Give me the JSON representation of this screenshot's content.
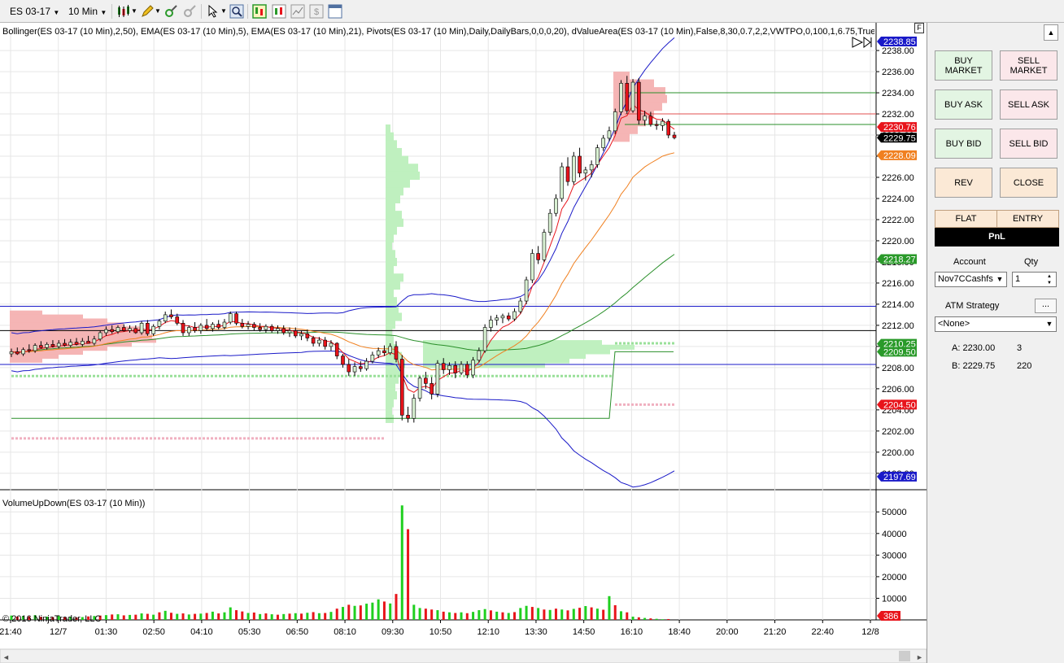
{
  "toolbar": {
    "instrument": "ES 03-17",
    "interval": "10 Min",
    "icons": [
      "candlestick-icon",
      "pencil-icon",
      "crosshair-icon",
      "magnet-icon",
      "cursor-icon",
      "zoom-icon",
      "properties-icon",
      "chart-style-icon",
      "data-box-icon",
      "dollar-icon"
    ]
  },
  "chart": {
    "indicator_label": "Bollinger(ES 03-17 (10 Min),2,50), EMA(ES 03-17 (10 Min),5), EMA(ES 03-17 (10 Min),21), Pivots(ES 03-17 (10 Min),Daily,DailyBars,0,0,0,20), dValueArea(ES 03-17 (10 Min),False,8,30,0.7,2,2,VWTPO,0,100,1,6.75,True",
    "volume_label": "VolumeUpDown(ES 03-17 (10 Min))",
    "copyright": "© 2016 NinjaTrader, LLC",
    "f_label": "F",
    "colors": {
      "up": "#d8f0d2",
      "down": "#e8141b",
      "ema5": "#e8141b",
      "ema21": "#f08020",
      "bollinger": "#1a1ac8",
      "pivot_green": "#2a8f2a",
      "pivot_red": "#e05050"
    }
  },
  "chart_data": {
    "type": "candlestick",
    "price_axis": {
      "ticks": [
        "2238.00",
        "2236.00",
        "2234.00",
        "2232.00",
        "2230.00",
        "2228.00",
        "2226.00",
        "2224.00",
        "2222.00",
        "2220.00",
        "2218.00",
        "2216.00",
        "2214.00",
        "2212.00",
        "2210.00",
        "2208.00",
        "2206.00",
        "2204.00",
        "2202.00",
        "2200.00",
        "2198.00"
      ],
      "ylim": [
        2196.6,
        2239.7
      ]
    },
    "volume_axis": {
      "ticks": [
        "50000",
        "40000",
        "30000",
        "20000",
        "10000"
      ],
      "ylim": [
        0,
        58000
      ]
    },
    "time_axis": [
      "21:40",
      "12/7",
      "01:30",
      "02:50",
      "04:10",
      "05:30",
      "06:50",
      "08:10",
      "09:30",
      "10:50",
      "12:10",
      "13:30",
      "14:50",
      "16:10",
      "18:40",
      "20:00",
      "21:20",
      "22:40",
      "12/8"
    ],
    "price_markers": [
      {
        "label": "2238.85",
        "price": 2238.85,
        "color": "#1a1ac8"
      },
      {
        "label": "2230.76",
        "price": 2230.76,
        "color": "#e8141b"
      },
      {
        "label": "2229.75",
        "price": 2229.75,
        "color": "#000000"
      },
      {
        "label": "2228.09",
        "price": 2228.09,
        "color": "#f08020"
      },
      {
        "label": "2218.27",
        "price": 2218.27,
        "color": "#2a9a2a"
      },
      {
        "label": "2210.25",
        "price": 2210.25,
        "color": "#2a9a2a"
      },
      {
        "label": "2209.50",
        "price": 2209.5,
        "color": "#2a9a2a"
      },
      {
        "label": "2204.50",
        "price": 2204.5,
        "color": "#e8141b"
      },
      {
        "label": "2197.69",
        "price": 2197.69,
        "color": "#1a1ac8"
      }
    ],
    "volume_marker": {
      "label": "386",
      "value": 386,
      "color": "#e8141b"
    },
    "candles": [
      [
        2209.3,
        2209.8,
        2209.0,
        2209.5
      ],
      [
        2209.5,
        2209.9,
        2209.2,
        2209.3
      ],
      [
        2209.3,
        2209.9,
        2209.1,
        2209.7
      ],
      [
        2209.7,
        2210.2,
        2209.4,
        2209.6
      ],
      [
        2209.6,
        2210.3,
        2209.4,
        2210.1
      ],
      [
        2210.1,
        2210.5,
        2209.8,
        2209.9
      ],
      [
        2209.9,
        2210.4,
        2209.7,
        2210.2
      ],
      [
        2210.2,
        2210.6,
        2209.9,
        2210.0
      ],
      [
        2210.0,
        2210.6,
        2209.8,
        2210.3
      ],
      [
        2210.3,
        2210.7,
        2210.0,
        2210.1
      ],
      [
        2210.1,
        2210.7,
        2209.9,
        2210.4
      ],
      [
        2210.4,
        2210.8,
        2210.1,
        2210.2
      ],
      [
        2210.2,
        2210.8,
        2210.0,
        2210.5
      ],
      [
        2210.5,
        2211.0,
        2210.3,
        2210.3
      ],
      [
        2210.3,
        2211.0,
        2210.1,
        2210.7
      ],
      [
        2210.7,
        2211.5,
        2210.5,
        2211.3
      ],
      [
        2211.3,
        2211.9,
        2211.0,
        2211.6
      ],
      [
        2211.6,
        2212.0,
        2211.2,
        2211.4
      ],
      [
        2211.4,
        2212.0,
        2211.2,
        2211.8
      ],
      [
        2211.8,
        2212.1,
        2211.4,
        2211.5
      ],
      [
        2211.5,
        2212.0,
        2211.3,
        2211.7
      ],
      [
        2211.7,
        2212.0,
        2211.2,
        2211.3
      ],
      [
        2211.3,
        2212.4,
        2211.1,
        2212.2
      ],
      [
        2212.2,
        2212.5,
        2211.0,
        2211.2
      ],
      [
        2211.2,
        2212.1,
        2211.0,
        2211.9
      ],
      [
        2211.9,
        2212.6,
        2211.6,
        2212.4
      ],
      [
        2212.4,
        2213.3,
        2212.2,
        2213.0
      ],
      [
        2213.0,
        2213.5,
        2212.6,
        2212.8
      ],
      [
        2212.8,
        2213.1,
        2212.0,
        2212.2
      ],
      [
        2212.2,
        2212.5,
        2211.0,
        2211.3
      ],
      [
        2211.3,
        2212.0,
        2211.0,
        2211.8
      ],
      [
        2211.8,
        2212.3,
        2211.3,
        2211.5
      ],
      [
        2211.5,
        2212.2,
        2211.2,
        2212.0
      ],
      [
        2212.0,
        2212.6,
        2211.5,
        2211.7
      ],
      [
        2211.7,
        2212.3,
        2211.4,
        2212.1
      ],
      [
        2212.1,
        2212.5,
        2211.6,
        2211.8
      ],
      [
        2211.8,
        2212.6,
        2211.6,
        2212.3
      ],
      [
        2212.3,
        2213.3,
        2212.1,
        2213.1
      ],
      [
        2213.1,
        2213.3,
        2212.0,
        2212.2
      ],
      [
        2212.2,
        2212.6,
        2211.7,
        2211.9
      ],
      [
        2211.9,
        2212.4,
        2211.6,
        2212.1
      ],
      [
        2212.1,
        2212.3,
        2211.5,
        2211.8
      ],
      [
        2211.8,
        2212.2,
        2211.4,
        2211.6
      ],
      [
        2211.6,
        2212.1,
        2211.3,
        2211.9
      ],
      [
        2211.9,
        2212.1,
        2211.3,
        2211.5
      ],
      [
        2211.5,
        2212.0,
        2211.2,
        2211.7
      ],
      [
        2211.7,
        2212.0,
        2211.1,
        2211.3
      ],
      [
        2211.3,
        2211.8,
        2210.9,
        2211.5
      ],
      [
        2211.5,
        2211.8,
        2210.8,
        2211.0
      ],
      [
        2211.0,
        2211.5,
        2210.6,
        2211.2
      ],
      [
        2211.2,
        2211.6,
        2210.5,
        2210.8
      ],
      [
        2210.8,
        2211.0,
        2210.0,
        2210.3
      ],
      [
        2210.3,
        2210.9,
        2210.0,
        2210.6
      ],
      [
        2210.6,
        2210.9,
        2209.7,
        2210.0
      ],
      [
        2210.0,
        2210.6,
        2209.6,
        2210.3
      ],
      [
        2210.3,
        2210.4,
        2208.8,
        2209.1
      ],
      [
        2209.1,
        2209.3,
        2208.0,
        2208.3
      ],
      [
        2208.3,
        2208.8,
        2207.2,
        2207.6
      ],
      [
        2207.6,
        2208.5,
        2207.2,
        2208.1
      ],
      [
        2208.1,
        2208.6,
        2207.6,
        2207.9
      ],
      [
        2207.9,
        2208.9,
        2207.7,
        2208.6
      ],
      [
        2208.6,
        2209.5,
        2208.4,
        2209.2
      ],
      [
        2209.2,
        2209.9,
        2208.9,
        2209.6
      ],
      [
        2209.6,
        2210.1,
        2209.1,
        2209.4
      ],
      [
        2209.4,
        2210.3,
        2209.2,
        2210.0
      ],
      [
        2210.0,
        2210.5,
        2208.5,
        2208.8
      ],
      [
        2208.8,
        2209.2,
        2203.0,
        2203.5
      ],
      [
        2203.5,
        2204.3,
        2202.8,
        2203.2
      ],
      [
        2203.2,
        2205.5,
        2202.8,
        2205.1
      ],
      [
        2205.1,
        2207.2,
        2204.8,
        2207.0
      ],
      [
        2207.0,
        2207.6,
        2206.0,
        2206.5
      ],
      [
        2206.5,
        2207.1,
        2205.0,
        2205.5
      ],
      [
        2205.5,
        2208.7,
        2205.2,
        2208.4
      ],
      [
        2208.4,
        2208.9,
        2207.4,
        2207.8
      ],
      [
        2207.8,
        2208.5,
        2207.3,
        2208.2
      ],
      [
        2208.2,
        2208.6,
        2207.0,
        2207.5
      ],
      [
        2207.5,
        2208.6,
        2207.3,
        2208.3
      ],
      [
        2208.3,
        2208.6,
        2207.0,
        2207.3
      ],
      [
        2207.3,
        2209.0,
        2207.0,
        2208.7
      ],
      [
        2208.7,
        2209.9,
        2208.5,
        2209.6
      ],
      [
        2209.6,
        2212.1,
        2209.4,
        2211.8
      ],
      [
        2211.8,
        2212.9,
        2211.4,
        2212.5
      ],
      [
        2212.5,
        2213.0,
        2212.0,
        2212.7
      ],
      [
        2212.7,
        2213.1,
        2212.2,
        2212.9
      ],
      [
        2212.9,
        2213.2,
        2212.4,
        2212.6
      ],
      [
        2212.6,
        2213.6,
        2212.4,
        2213.3
      ],
      [
        2213.3,
        2214.6,
        2213.1,
        2214.3
      ],
      [
        2214.3,
        2216.6,
        2214.0,
        2216.3
      ],
      [
        2216.3,
        2219.2,
        2216.0,
        2218.8
      ],
      [
        2218.8,
        2219.5,
        2217.8,
        2218.2
      ],
      [
        2218.2,
        2221.1,
        2218.0,
        2220.8
      ],
      [
        2220.8,
        2223.0,
        2220.5,
        2222.6
      ],
      [
        2222.6,
        2224.4,
        2222.3,
        2224.0
      ],
      [
        2224.0,
        2227.4,
        2223.7,
        2227.0
      ],
      [
        2227.0,
        2227.9,
        2225.2,
        2225.6
      ],
      [
        2225.6,
        2228.4,
        2225.3,
        2228.0
      ],
      [
        2228.0,
        2228.8,
        2226.0,
        2226.4
      ],
      [
        2226.4,
        2227.0,
        2225.7,
        2226.7
      ],
      [
        2226.7,
        2227.6,
        2226.0,
        2227.2
      ],
      [
        2227.2,
        2229.1,
        2226.9,
        2228.8
      ],
      [
        2228.8,
        2230.0,
        2228.5,
        2229.7
      ],
      [
        2229.7,
        2230.8,
        2229.4,
        2230.4
      ],
      [
        2230.4,
        2232.5,
        2230.1,
        2232.2
      ],
      [
        2232.2,
        2235.2,
        2231.9,
        2234.9
      ],
      [
        2234.9,
        2235.6,
        2232.0,
        2232.3
      ],
      [
        2232.3,
        2235.3,
        2232.1,
        2235.0
      ],
      [
        2235.0,
        2235.4,
        2231.0,
        2231.4
      ],
      [
        2231.4,
        2232.3,
        2230.9,
        2231.8
      ],
      [
        2231.8,
        2232.2,
        2230.8,
        2231.0
      ],
      [
        2231.0,
        2231.4,
        2230.5,
        2230.9
      ],
      [
        2230.9,
        2231.6,
        2230.4,
        2231.3
      ],
      [
        2231.3,
        2231.5,
        2229.7,
        2230.0
      ],
      [
        2230.0,
        2230.3,
        2229.6,
        2229.75
      ]
    ],
    "volume": [
      [
        2000,
        "up"
      ],
      [
        1500,
        "down"
      ],
      [
        1800,
        "up"
      ],
      [
        1600,
        "down"
      ],
      [
        2200,
        "up"
      ],
      [
        1400,
        "down"
      ],
      [
        1500,
        "up"
      ],
      [
        1300,
        "down"
      ],
      [
        1800,
        "up"
      ],
      [
        1200,
        "down"
      ],
      [
        1500,
        "up"
      ],
      [
        1100,
        "down"
      ],
      [
        1300,
        "up"
      ],
      [
        1600,
        "down"
      ],
      [
        1800,
        "up"
      ],
      [
        2000,
        "down"
      ],
      [
        2200,
        "up"
      ],
      [
        2500,
        "down"
      ],
      [
        2600,
        "up"
      ],
      [
        2100,
        "down"
      ],
      [
        2300,
        "up"
      ],
      [
        2400,
        "down"
      ],
      [
        3000,
        "up"
      ],
      [
        2800,
        "down"
      ],
      [
        2400,
        "up"
      ],
      [
        3500,
        "down"
      ],
      [
        4200,
        "up"
      ],
      [
        3300,
        "down"
      ],
      [
        2800,
        "up"
      ],
      [
        3000,
        "down"
      ],
      [
        2500,
        "up"
      ],
      [
        2800,
        "down"
      ],
      [
        2900,
        "up"
      ],
      [
        3200,
        "down"
      ],
      [
        3800,
        "up"
      ],
      [
        3000,
        "down"
      ],
      [
        3500,
        "up"
      ],
      [
        5800,
        "up"
      ],
      [
        4500,
        "down"
      ],
      [
        3900,
        "down"
      ],
      [
        3200,
        "up"
      ],
      [
        3400,
        "down"
      ],
      [
        2700,
        "up"
      ],
      [
        3000,
        "down"
      ],
      [
        2600,
        "up"
      ],
      [
        2400,
        "down"
      ],
      [
        2700,
        "up"
      ],
      [
        2900,
        "down"
      ],
      [
        3100,
        "up"
      ],
      [
        2900,
        "down"
      ],
      [
        3300,
        "up"
      ],
      [
        3600,
        "down"
      ],
      [
        3100,
        "up"
      ],
      [
        3200,
        "down"
      ],
      [
        3700,
        "up"
      ],
      [
        5200,
        "down"
      ],
      [
        6000,
        "up"
      ],
      [
        7000,
        "down"
      ],
      [
        6500,
        "up"
      ],
      [
        6700,
        "down"
      ],
      [
        7500,
        "up"
      ],
      [
        8000,
        "up"
      ],
      [
        9500,
        "up"
      ],
      [
        8500,
        "down"
      ],
      [
        7600,
        "up"
      ],
      [
        12000,
        "down"
      ],
      [
        53000,
        "up"
      ],
      [
        42000,
        "down"
      ],
      [
        7000,
        "up"
      ],
      [
        5500,
        "up"
      ],
      [
        5200,
        "down"
      ],
      [
        4800,
        "down"
      ],
      [
        4500,
        "up"
      ],
      [
        3800,
        "down"
      ],
      [
        3500,
        "up"
      ],
      [
        3200,
        "down"
      ],
      [
        3500,
        "up"
      ],
      [
        3100,
        "down"
      ],
      [
        3700,
        "up"
      ],
      [
        4500,
        "up"
      ],
      [
        5000,
        "up"
      ],
      [
        4400,
        "down"
      ],
      [
        3800,
        "up"
      ],
      [
        3500,
        "down"
      ],
      [
        3200,
        "up"
      ],
      [
        3600,
        "down"
      ],
      [
        5500,
        "up"
      ],
      [
        6500,
        "up"
      ],
      [
        6000,
        "down"
      ],
      [
        5500,
        "up"
      ],
      [
        4800,
        "down"
      ],
      [
        4600,
        "up"
      ],
      [
        5200,
        "down"
      ],
      [
        4800,
        "up"
      ],
      [
        4400,
        "down"
      ],
      [
        5100,
        "up"
      ],
      [
        5600,
        "down"
      ],
      [
        6400,
        "up"
      ],
      [
        5800,
        "down"
      ],
      [
        5200,
        "up"
      ],
      [
        4700,
        "down"
      ],
      [
        11000,
        "up"
      ],
      [
        6800,
        "down"
      ],
      [
        4000,
        "up"
      ],
      [
        3500,
        "down"
      ],
      [
        1500,
        "up"
      ],
      [
        1200,
        "down"
      ],
      [
        900,
        "up"
      ],
      [
        700,
        "down"
      ],
      [
        500,
        "up"
      ],
      [
        300,
        "up"
      ],
      [
        386,
        "down"
      ]
    ],
    "lines": {
      "pivot_upper_green": 2234.0,
      "pivot_red": 2232.0,
      "pivot_mid_green": 2231.0,
      "blue_upper": 2213.8,
      "black_mid": 2211.5,
      "blue_lower": 2208.3
    }
  },
  "panel": {
    "buttons": {
      "buy_market": "BUY MARKET",
      "sell_market": "SELL MARKET",
      "buy_ask": "BUY ASK",
      "sell_ask": "SELL ASK",
      "buy_bid": "BUY BID",
      "sell_bid": "SELL BID",
      "rev": "REV",
      "close": "CLOSE"
    },
    "flat": "FLAT",
    "entry": "ENTRY",
    "pnl": "PnL",
    "account_label": "Account",
    "qty_label": "Qty",
    "account_value": "Nov7CCashfs",
    "qty_value": "1",
    "atm_label": "ATM Strategy",
    "atm_button": "...",
    "atm_value": "<None>",
    "ask_label": "A: 2230.00",
    "ask_size": "3",
    "bid_label": "B: 2229.75",
    "bid_size": "220"
  }
}
